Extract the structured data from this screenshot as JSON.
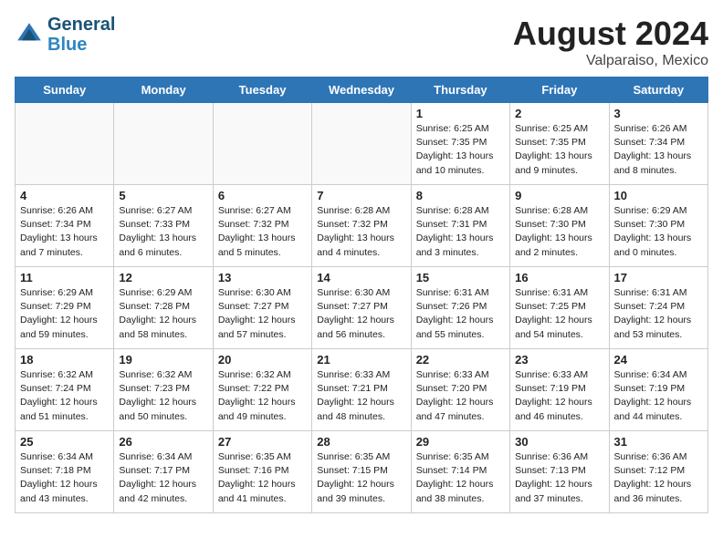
{
  "header": {
    "logo_line1": "General",
    "logo_line2": "Blue",
    "month_title": "August 2024",
    "location": "Valparaiso, Mexico"
  },
  "days_of_week": [
    "Sunday",
    "Monday",
    "Tuesday",
    "Wednesday",
    "Thursday",
    "Friday",
    "Saturday"
  ],
  "weeks": [
    [
      {
        "day": "",
        "info": "",
        "empty": true
      },
      {
        "day": "",
        "info": "",
        "empty": true
      },
      {
        "day": "",
        "info": "",
        "empty": true
      },
      {
        "day": "",
        "info": "",
        "empty": true
      },
      {
        "day": "1",
        "info": "Sunrise: 6:25 AM\nSunset: 7:35 PM\nDaylight: 13 hours\nand 10 minutes."
      },
      {
        "day": "2",
        "info": "Sunrise: 6:25 AM\nSunset: 7:35 PM\nDaylight: 13 hours\nand 9 minutes."
      },
      {
        "day": "3",
        "info": "Sunrise: 6:26 AM\nSunset: 7:34 PM\nDaylight: 13 hours\nand 8 minutes."
      }
    ],
    [
      {
        "day": "4",
        "info": "Sunrise: 6:26 AM\nSunset: 7:34 PM\nDaylight: 13 hours\nand 7 minutes."
      },
      {
        "day": "5",
        "info": "Sunrise: 6:27 AM\nSunset: 7:33 PM\nDaylight: 13 hours\nand 6 minutes."
      },
      {
        "day": "6",
        "info": "Sunrise: 6:27 AM\nSunset: 7:32 PM\nDaylight: 13 hours\nand 5 minutes."
      },
      {
        "day": "7",
        "info": "Sunrise: 6:28 AM\nSunset: 7:32 PM\nDaylight: 13 hours\nand 4 minutes."
      },
      {
        "day": "8",
        "info": "Sunrise: 6:28 AM\nSunset: 7:31 PM\nDaylight: 13 hours\nand 3 minutes."
      },
      {
        "day": "9",
        "info": "Sunrise: 6:28 AM\nSunset: 7:30 PM\nDaylight: 13 hours\nand 2 minutes."
      },
      {
        "day": "10",
        "info": "Sunrise: 6:29 AM\nSunset: 7:30 PM\nDaylight: 13 hours\nand 0 minutes."
      }
    ],
    [
      {
        "day": "11",
        "info": "Sunrise: 6:29 AM\nSunset: 7:29 PM\nDaylight: 12 hours\nand 59 minutes."
      },
      {
        "day": "12",
        "info": "Sunrise: 6:29 AM\nSunset: 7:28 PM\nDaylight: 12 hours\nand 58 minutes."
      },
      {
        "day": "13",
        "info": "Sunrise: 6:30 AM\nSunset: 7:27 PM\nDaylight: 12 hours\nand 57 minutes."
      },
      {
        "day": "14",
        "info": "Sunrise: 6:30 AM\nSunset: 7:27 PM\nDaylight: 12 hours\nand 56 minutes."
      },
      {
        "day": "15",
        "info": "Sunrise: 6:31 AM\nSunset: 7:26 PM\nDaylight: 12 hours\nand 55 minutes."
      },
      {
        "day": "16",
        "info": "Sunrise: 6:31 AM\nSunset: 7:25 PM\nDaylight: 12 hours\nand 54 minutes."
      },
      {
        "day": "17",
        "info": "Sunrise: 6:31 AM\nSunset: 7:24 PM\nDaylight: 12 hours\nand 53 minutes."
      }
    ],
    [
      {
        "day": "18",
        "info": "Sunrise: 6:32 AM\nSunset: 7:24 PM\nDaylight: 12 hours\nand 51 minutes."
      },
      {
        "day": "19",
        "info": "Sunrise: 6:32 AM\nSunset: 7:23 PM\nDaylight: 12 hours\nand 50 minutes."
      },
      {
        "day": "20",
        "info": "Sunrise: 6:32 AM\nSunset: 7:22 PM\nDaylight: 12 hours\nand 49 minutes."
      },
      {
        "day": "21",
        "info": "Sunrise: 6:33 AM\nSunset: 7:21 PM\nDaylight: 12 hours\nand 48 minutes."
      },
      {
        "day": "22",
        "info": "Sunrise: 6:33 AM\nSunset: 7:20 PM\nDaylight: 12 hours\nand 47 minutes."
      },
      {
        "day": "23",
        "info": "Sunrise: 6:33 AM\nSunset: 7:19 PM\nDaylight: 12 hours\nand 46 minutes."
      },
      {
        "day": "24",
        "info": "Sunrise: 6:34 AM\nSunset: 7:19 PM\nDaylight: 12 hours\nand 44 minutes."
      }
    ],
    [
      {
        "day": "25",
        "info": "Sunrise: 6:34 AM\nSunset: 7:18 PM\nDaylight: 12 hours\nand 43 minutes."
      },
      {
        "day": "26",
        "info": "Sunrise: 6:34 AM\nSunset: 7:17 PM\nDaylight: 12 hours\nand 42 minutes."
      },
      {
        "day": "27",
        "info": "Sunrise: 6:35 AM\nSunset: 7:16 PM\nDaylight: 12 hours\nand 41 minutes."
      },
      {
        "day": "28",
        "info": "Sunrise: 6:35 AM\nSunset: 7:15 PM\nDaylight: 12 hours\nand 39 minutes."
      },
      {
        "day": "29",
        "info": "Sunrise: 6:35 AM\nSunset: 7:14 PM\nDaylight: 12 hours\nand 38 minutes."
      },
      {
        "day": "30",
        "info": "Sunrise: 6:36 AM\nSunset: 7:13 PM\nDaylight: 12 hours\nand 37 minutes."
      },
      {
        "day": "31",
        "info": "Sunrise: 6:36 AM\nSunset: 7:12 PM\nDaylight: 12 hours\nand 36 minutes."
      }
    ]
  ]
}
